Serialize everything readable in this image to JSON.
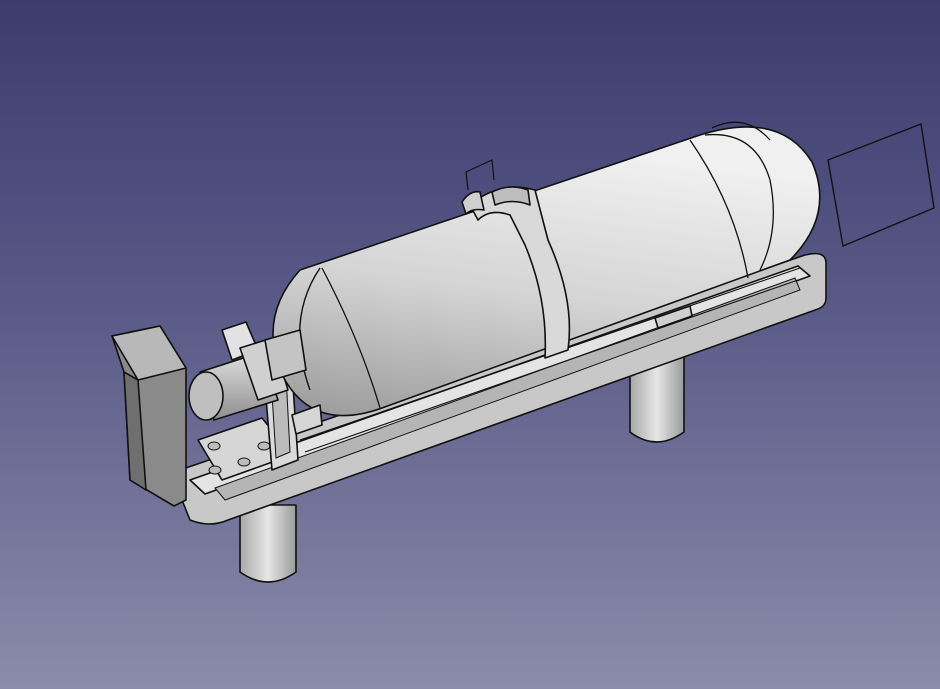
{
  "view": {
    "background_top": "#3b3b6e",
    "background_bottom": "#8b8bab",
    "model_color": "#cfcfcf",
    "edge_color": "#111111"
  },
  "scene": {
    "objects": [
      "tank-body-icon",
      "tank-strap-icon",
      "valve-cylinder-icon",
      "end-block-icon",
      "mounting-tray-icon",
      "support-leg-icon",
      "plane-outline-icon"
    ]
  }
}
